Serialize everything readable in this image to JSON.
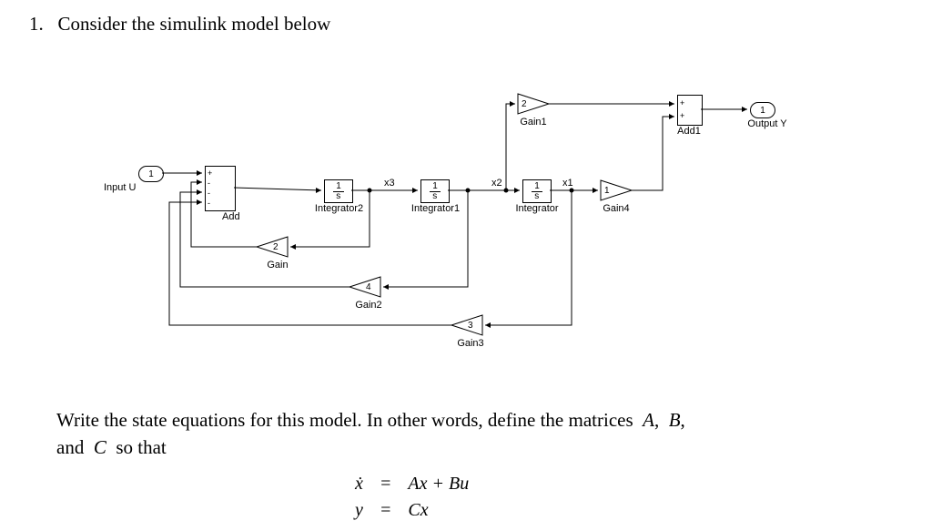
{
  "problem_number": "1.",
  "prompt_text": "Consider the simulink model below",
  "question_text_1": "Write the state equations for this model. In other words, define the matrices",
  "question_text_matrices": "A",
  "question_text_comma": ",",
  "question_text_B": "B",
  "question_text_and": "and",
  "question_text_C": "C",
  "question_text_so": "so that",
  "eq1_lhs": "ẋ",
  "eq1_rhs": "Ax + Bu",
  "eq2_lhs": "y",
  "eq2_rhs": "Cx",
  "eq_equals": "=",
  "ports": {
    "input_u": {
      "num": "1",
      "label": "Input U"
    },
    "output_y": {
      "num": "1",
      "label": "Output Y"
    }
  },
  "blocks": {
    "add": {
      "label": "Add",
      "signs": [
        "+",
        "-",
        "-",
        "-"
      ]
    },
    "add1": {
      "label": "Add1",
      "signs": [
        "+",
        "+"
      ]
    },
    "integrator2": {
      "label": "Integrator2",
      "num": "1",
      "den": "s"
    },
    "integrator1": {
      "label": "Integrator1",
      "num": "1",
      "den": "s"
    },
    "integrator": {
      "label": "Integrator",
      "num": "1",
      "den": "s"
    },
    "gain": {
      "label": "Gain",
      "value": "2"
    },
    "gain1": {
      "label": "Gain1",
      "value": "2"
    },
    "gain2": {
      "label": "Gain2",
      "value": "4"
    },
    "gain3": {
      "label": "Gain3",
      "value": "3"
    },
    "gain4": {
      "label": "Gain4",
      "value": "1"
    }
  },
  "signals": {
    "x1": "x1",
    "x2": "x2",
    "x3": "x3"
  },
  "chart_data": {
    "type": "table",
    "description": "Simulink block diagram connectivity",
    "states": [
      "x1",
      "x2",
      "x3"
    ],
    "integrators": {
      "Integrator": {
        "output": "x1",
        "input": "x2"
      },
      "Integrator1": {
        "output": "x2",
        "input": "x3"
      },
      "Integrator2": {
        "output": "x3",
        "input": "Add.out"
      }
    },
    "gains": {
      "Gain": {
        "value": 2,
        "input": "x3",
        "output_to": "Add.-1"
      },
      "Gain1": {
        "value": 2,
        "input": "x2",
        "output_to": "Add1.+1"
      },
      "Gain2": {
        "value": 4,
        "input": "x2",
        "output_to": "Add.-2"
      },
      "Gain3": {
        "value": 3,
        "input": "x1",
        "output_to": "Add.-3"
      },
      "Gain4": {
        "value": 1,
        "input": "x1",
        "output_to": "Add1.+2"
      }
    },
    "sums": {
      "Add": {
        "inputs": [
          "+ Input U",
          "- Gain",
          "- Gain2",
          "- Gain3"
        ],
        "output": "Integrator2.in"
      },
      "Add1": {
        "inputs": [
          "+ Gain1",
          "+ Gain4"
        ],
        "output": "Output Y"
      }
    },
    "input": "Input U → Add.+",
    "output": "Add1.out → Output Y"
  }
}
